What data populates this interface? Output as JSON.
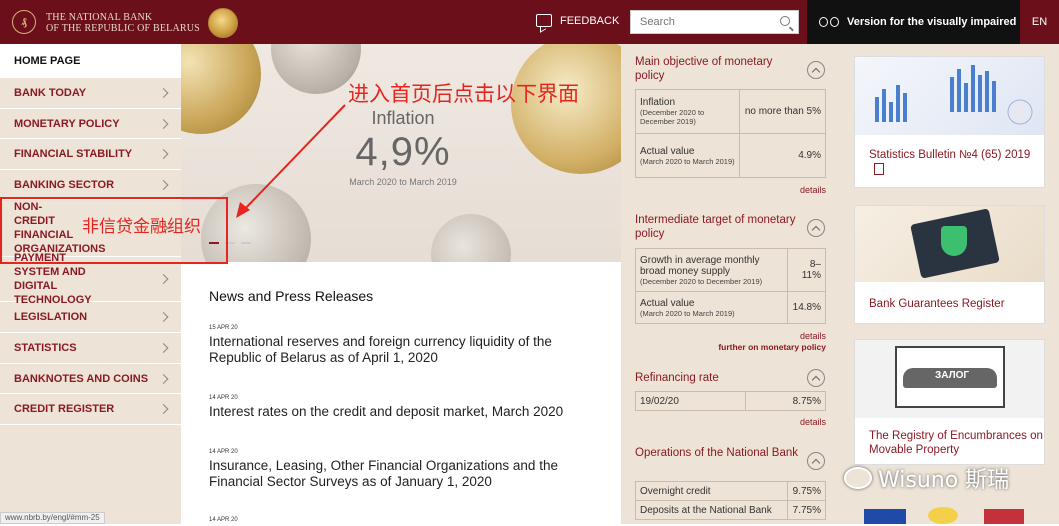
{
  "header": {
    "logo_line1": "THE NATIONAL BANK",
    "logo_line2": "OF THE REPUBLIC OF BELARUS",
    "feedback_label": "FEEDBACK",
    "search_placeholder": "Search",
    "visually_impaired_label": "Version for the visually impaired",
    "language": "EN"
  },
  "sidebar": {
    "items": [
      {
        "label": "HOME PAGE"
      },
      {
        "label": "BANK TODAY"
      },
      {
        "label": "MONETARY POLICY"
      },
      {
        "label": "FINANCIAL STABILITY"
      },
      {
        "label": "BANKING SECTOR"
      },
      {
        "label": "NON-CREDIT FINANCIAL ORGANIZATIONS"
      },
      {
        "label": "PAYMENT SYSTEM AND DIGITAL TECHNOLOGY"
      },
      {
        "label": "LEGISLATION"
      },
      {
        "label": "STATISTICS"
      },
      {
        "label": "BANKNOTES AND COINS"
      },
      {
        "label": "CREDIT REGISTER"
      }
    ]
  },
  "hero": {
    "label": "Inflation",
    "value": "4,9%",
    "period": "March 2020 to March 2019"
  },
  "annotations": {
    "top": "进入首页后点击以下界面",
    "side": "非信贷金融组织"
  },
  "news": {
    "heading": "News and Press Releases",
    "items": [
      {
        "date": "15 APR 20",
        "title": "International reserves and foreign currency liquidity of the Republic of Belarus as of April 1, 2020"
      },
      {
        "date": "14 APR 20",
        "title": "Interest rates on the credit and deposit market, March 2020"
      },
      {
        "date": "14 APR 20",
        "title": "Insurance, Leasing, Other Financial Organizations and the Financial Sector Surveys as of January 1, 2020"
      },
      {
        "date": "14 APR 20",
        "title": ""
      }
    ]
  },
  "status_url": "www.nbrb.by/engl/#mm-25",
  "panel": {
    "main_objective": {
      "title": "Main objective of monetary policy",
      "rows": [
        {
          "label": "Inflation",
          "sub": "(December 2020 to December 2019)",
          "value": "no more than 5%"
        },
        {
          "label": "Actual value",
          "sub": "(March 2020 to March 2019)",
          "value": "4.9%"
        }
      ],
      "details": "details"
    },
    "intermediate": {
      "title": "Intermediate target of monetary policy",
      "rows": [
        {
          "label": "Growth in average monthly broad money supply",
          "sub": "(December 2020 to December 2019)",
          "value": "8–11%"
        },
        {
          "label": "Actual value",
          "sub": "(March 2020 to March 2019)",
          "value": "14.8%"
        }
      ],
      "details": "details",
      "further": "further on monetary policy"
    },
    "refinancing": {
      "title": "Refinancing rate",
      "date": "19/02/20",
      "value": "8.75%",
      "details": "details"
    },
    "operations": {
      "title": "Operations of the National Bank",
      "rows": [
        {
          "label": "Overnight credit",
          "value": "9.75%"
        },
        {
          "label": "Deposits at the National Bank",
          "value": "7.75%"
        }
      ]
    }
  },
  "cards": [
    {
      "title": "Statistics Bulletin №4 (65) 2019"
    },
    {
      "title": "Bank Guarantees Register"
    },
    {
      "title": "The Registry of Encumbrances on Movable Property",
      "banner": "ЗАЛОГ"
    }
  ],
  "watermark": "Wisuno 斯瑞",
  "colors": {
    "brand": "#6b0f1a",
    "accent": "#8a1a24",
    "annotation": "#e5251e",
    "panel_bg": "#ede3d6"
  }
}
